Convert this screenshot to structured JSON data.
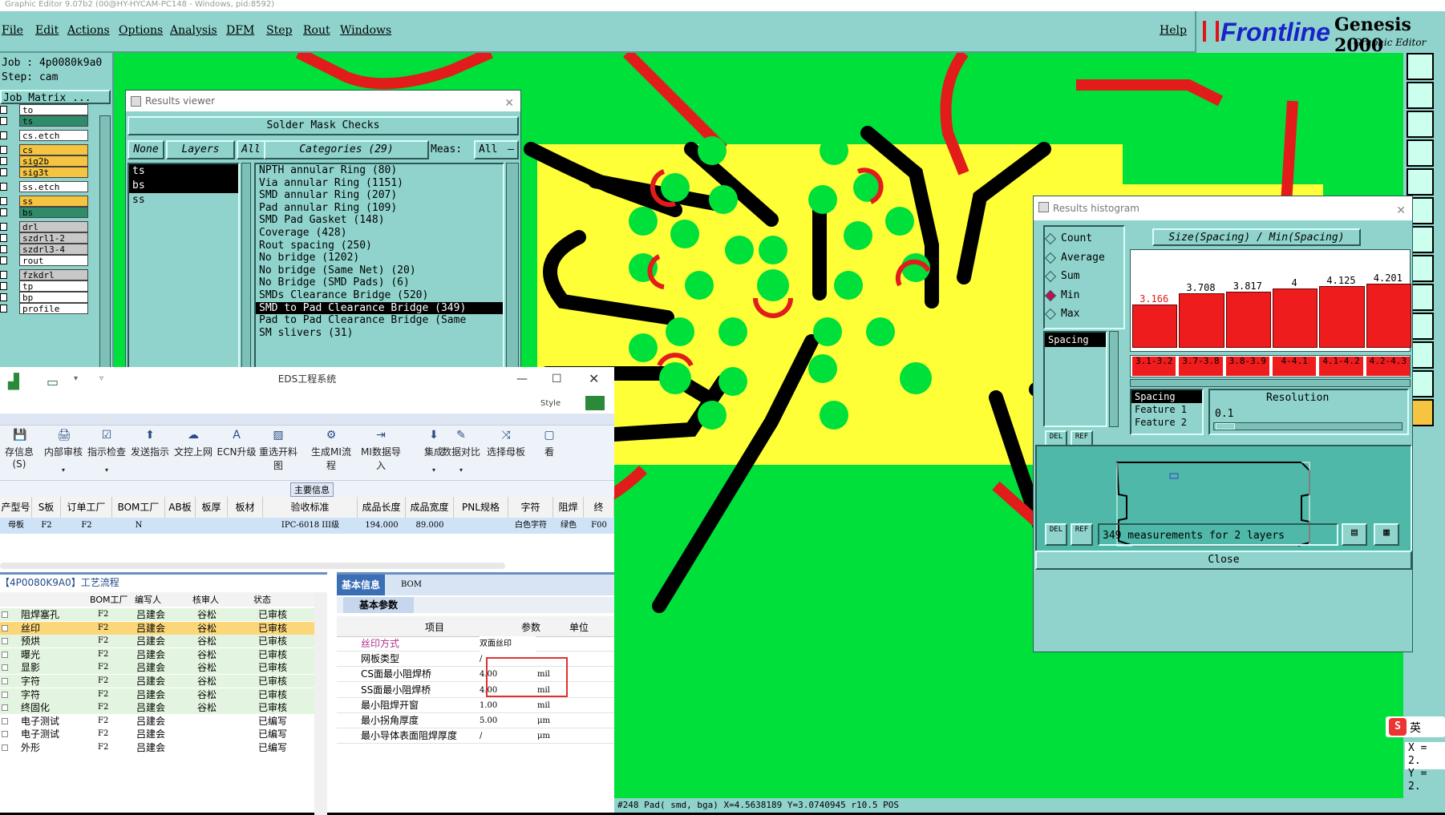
{
  "app_title": "Graphic Editor 9.07b2 (00@HY-HYCAM-PC148 - Windows, pid:8592)",
  "menu": [
    "File",
    "Edit",
    "Actions",
    "Options",
    "Analysis",
    "DFM",
    "Step",
    "Rout",
    "Windows"
  ],
  "help": "Help",
  "brand": {
    "logo": "Frontline",
    "title": "Genesis 2000",
    "subtitle": "Graphic Editor"
  },
  "job": {
    "job": "Job : 4p0080k9a0",
    "step": "Step: cam",
    "matrix": "Job Matrix ..."
  },
  "layers": [
    {
      "name": "to",
      "color": "#ffffff"
    },
    {
      "name": "ts",
      "color": "#2f8c6a"
    },
    {
      "name": "cs.etch",
      "color": "#ffffff"
    },
    {
      "name": "cs",
      "color": "#f5c542"
    },
    {
      "name": "sig2b",
      "color": "#f5c542"
    },
    {
      "name": "sig3t",
      "color": "#f5c542"
    },
    {
      "name": "ss.etch",
      "color": "#ffffff"
    },
    {
      "name": "ss",
      "color": "#f5c542"
    },
    {
      "name": "bs",
      "color": "#2f8c6a"
    },
    {
      "name": "drl",
      "color": "#c8c8c8"
    },
    {
      "name": "szdrl1-2",
      "color": "#c8c8c8"
    },
    {
      "name": "szdrl3-4",
      "color": "#c8c8c8"
    },
    {
      "name": "rout",
      "color": "#ffffff"
    },
    {
      "name": "fzkdrl",
      "color": "#c8c8c8"
    },
    {
      "name": "tp",
      "color": "#ffffff"
    },
    {
      "name": "bp",
      "color": "#ffffff"
    },
    {
      "name": "profile",
      "color": "#ffffff"
    }
  ],
  "results_viewer": {
    "title": "Results viewer",
    "header": "Solder Mask Checks",
    "btn_none": "None",
    "btn_layers": "Layers",
    "btn_all": "All",
    "categories_label": "Categories (29)",
    "meas_label": "Meas:",
    "meas_value": "All",
    "layer_list": [
      "ts",
      "bs",
      "ss"
    ],
    "categories": [
      "NPTH annular Ring (80)",
      "Via annular Ring (1151)",
      "SMD annular Ring (207)",
      "Pad annular Ring (109)",
      "SMD Pad Gasket (148)",
      "Coverage (428)",
      "Rout spacing (250)",
      "No bridge (1202)",
      "No bridge (Same Net) (20)",
      "No Bridge (SMD Pads) (6)",
      "SMDs Clearance Bridge (520)",
      "SMD to Pad Clearance Bridge (349)",
      "Pad to Pad Clearance Bridge (Same",
      "SM slivers (31)"
    ]
  },
  "results_histogram": {
    "title": "Results histogram",
    "options": [
      "Count",
      "Average",
      "Sum",
      "Min",
      "Max"
    ],
    "selected_option": "Min",
    "header": "Size(Spacing) / Min(Spacing)",
    "bars": [
      {
        "value": "3.166",
        "range": "3.1-3.2",
        "level": 0.62
      },
      {
        "value": "3.708",
        "range": "3.7-3.8",
        "level": 0.73
      },
      {
        "value": "3.817",
        "range": "3.8-3.9",
        "level": 0.75
      },
      {
        "value": "4",
        "range": "4-4.1",
        "level": 0.78
      },
      {
        "value": "4.125",
        "range": "4.1-4.2",
        "level": 0.81
      },
      {
        "value": "4.201",
        "range": "4.2-4.3",
        "level": 0.83
      }
    ],
    "measure_list": [
      "Spacing"
    ],
    "feature_list": [
      "Spacing",
      "Feature 1",
      "Feature 2"
    ],
    "resolution_label": "Resolution",
    "resolution_value": "0.1",
    "btn_del": "DEL",
    "btn_ref": "REF",
    "summary": "349 measurements for 2 layers",
    "close": "Close"
  },
  "status_bar": "#248 Pad( smd, bga) X=4.5638189 Y=3.0740945 r10.5 POS",
  "coords": {
    "x": "X = 2.",
    "y": "Y = 2."
  },
  "ime": {
    "icon": "S",
    "text": "英"
  },
  "eds": {
    "title": "EDS工程系统",
    "style_label": "Style",
    "ribbon": [
      "存信息(S)",
      "内部审核",
      "指示检查",
      "发送指示",
      "文控上网",
      "ECN升级",
      "重选开料图",
      "生成MI流程",
      "MI数据导入",
      "集成",
      "数据对比",
      "选择母板",
      "看"
    ],
    "section_label": "主要信息",
    "columns": [
      "产型号",
      "S板",
      "订单工厂",
      "BOM工厂",
      "AB板",
      "板厚",
      "板材",
      "验收标准",
      "成品长度",
      "成品宽度",
      "PNL规格",
      "字符",
      "阻焊",
      "终"
    ],
    "row": [
      "母板",
      "F2",
      "F2",
      "N",
      "",
      "",
      "",
      "IPC-6018 III级",
      "194.000",
      "89.000",
      "",
      "白色字符",
      "绿色",
      "F00"
    ],
    "flow_title": "【4P0080K9A0】工艺流程",
    "flow_columns": [
      "BOM工厂",
      "编写人",
      "核审人",
      "状态"
    ],
    "flow_rows": [
      {
        "name": "阻焊塞孔",
        "f": "F2",
        "w": "吕建会",
        "r": "谷松",
        "s": "已审核"
      },
      {
        "name": "丝印",
        "f": "F2",
        "w": "吕建会",
        "r": "谷松",
        "s": "已审核"
      },
      {
        "name": "预烘",
        "f": "F2",
        "w": "吕建会",
        "r": "谷松",
        "s": "已审核"
      },
      {
        "name": "曝光",
        "f": "F2",
        "w": "吕建会",
        "r": "谷松",
        "s": "已审核"
      },
      {
        "name": "显影",
        "f": "F2",
        "w": "吕建会",
        "r": "谷松",
        "s": "已审核"
      },
      {
        "name": "字符",
        "f": "F2",
        "w": "吕建会",
        "r": "谷松",
        "s": "已审核"
      },
      {
        "name": "字符",
        "f": "F2",
        "w": "吕建会",
        "r": "谷松",
        "s": "已审核"
      },
      {
        "name": "终固化",
        "f": "F2",
        "w": "吕建会",
        "r": "谷松",
        "s": "已审核"
      },
      {
        "name": "电子测试",
        "f": "F2",
        "w": "吕建会",
        "r": "",
        "s": "已编写"
      },
      {
        "name": "电子测试",
        "f": "F2",
        "w": "吕建会",
        "r": "",
        "s": "已编写"
      },
      {
        "name": "外形",
        "f": "F2",
        "w": "吕建会",
        "r": "",
        "s": "已编写"
      }
    ],
    "tab_basic": "基本信息",
    "tab_bom": "BOM",
    "sub_tab": "基本参数",
    "param_columns": [
      "项目",
      "参数",
      "单位"
    ],
    "params": [
      {
        "item": "丝印方式",
        "value": "双面丝印",
        "unit": ""
      },
      {
        "item": "网板类型",
        "value": "/",
        "unit": ""
      },
      {
        "item": "CS面最小阻焊桥",
        "value": "4.00",
        "unit": "mil"
      },
      {
        "item": "SS面最小阻焊桥",
        "value": "4.00",
        "unit": "mil"
      },
      {
        "item": "最小阻焊开窗",
        "value": "1.00",
        "unit": "mil"
      },
      {
        "item": "最小拐角厚度",
        "value": "5.00",
        "unit": "μm"
      },
      {
        "item": "最小导体表面阻焊厚度",
        "value": "/",
        "unit": "μm"
      }
    ]
  }
}
